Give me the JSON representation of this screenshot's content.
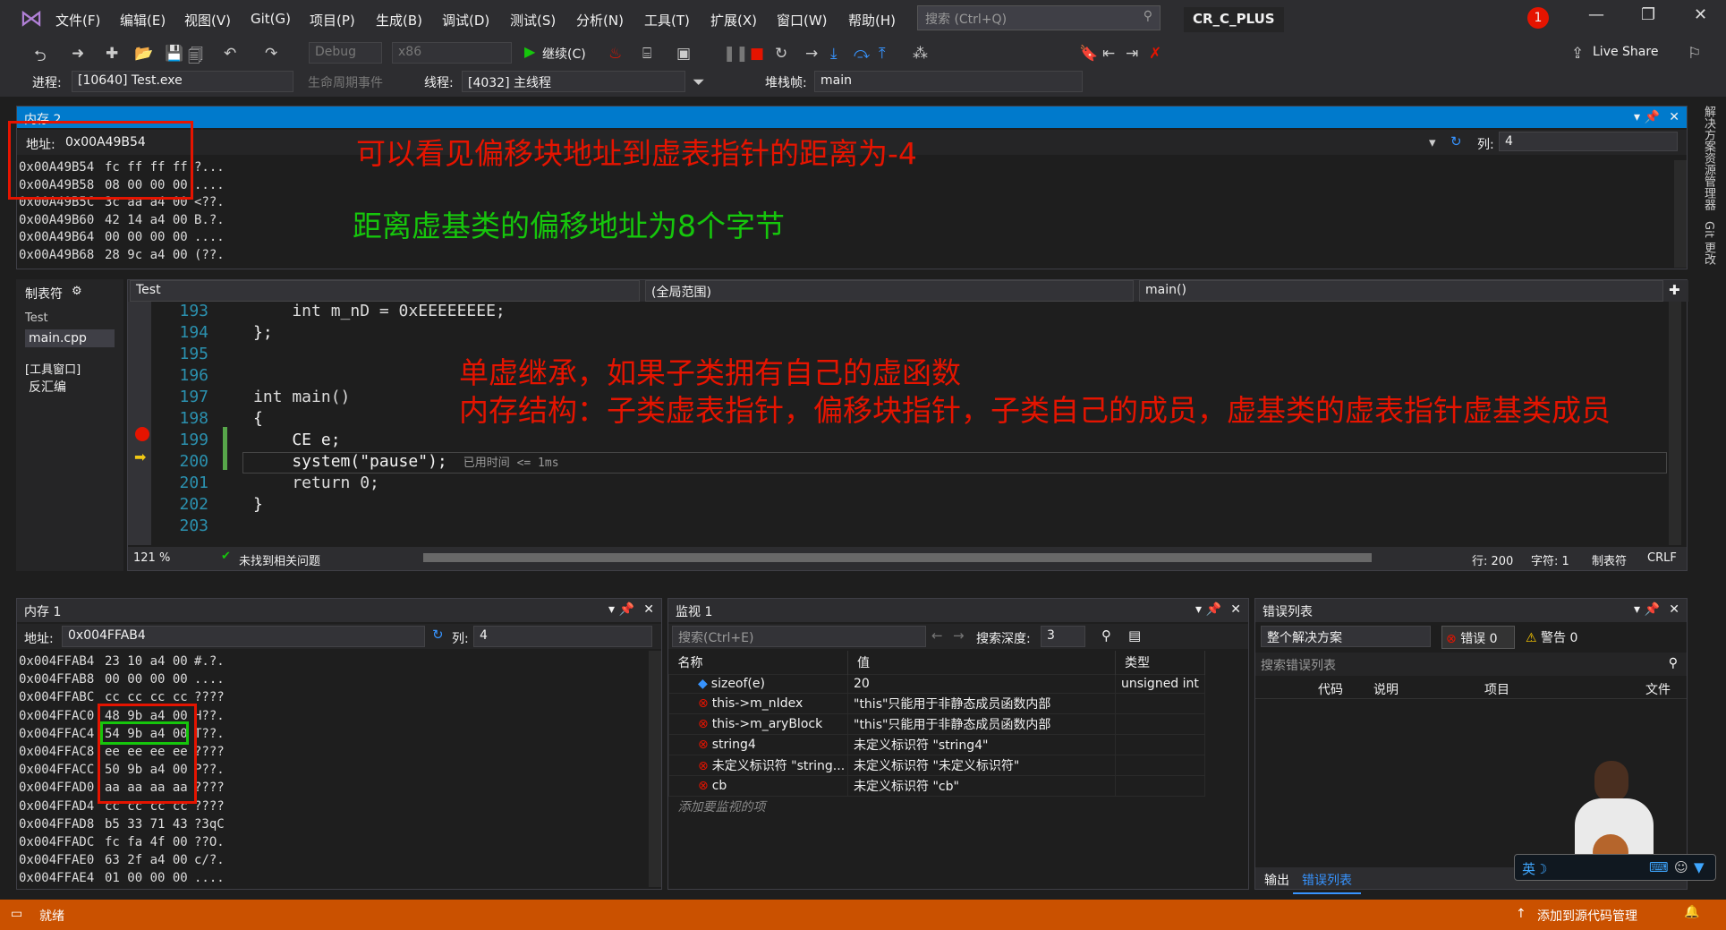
{
  "menubar": {
    "items": [
      "文件(F)",
      "编辑(E)",
      "视图(V)",
      "Git(G)",
      "项目(P)",
      "生成(B)",
      "调试(D)",
      "测试(S)",
      "分析(N)",
      "工具(T)",
      "扩展(X)",
      "窗口(W)",
      "帮助(H)"
    ],
    "search_placeholder": "搜索 (Ctrl+Q)",
    "solution_title": "CR_C_PLUS",
    "notification_count": "1"
  },
  "toolbar": {
    "config": "Debug",
    "platform": "x86",
    "continue_label": "继续(C)",
    "live_share": "Live Share"
  },
  "debugbar": {
    "process_label": "进程:",
    "process_value": "[10640] Test.exe",
    "lifecycle_label": "生命周期事件",
    "thread_label": "线程:",
    "thread_value": "[4032] 主线程",
    "stackframe_label": "堆栈帧:",
    "stackframe_value": "main"
  },
  "memory2": {
    "title": "内存 2",
    "address_label": "地址:",
    "address_value": "0x00A49B54",
    "col_label": "列:",
    "col_value": "4",
    "rows": [
      {
        "addr": "0x00A49B54",
        "bytes": "fc ff ff ff",
        "ascii": "?..."
      },
      {
        "addr": "0x00A49B58",
        "bytes": "08 00 00 00",
        "ascii": "...."
      },
      {
        "addr": "0x00A49B5C",
        "bytes": "3c aa a4 00",
        "ascii": "<??."
      },
      {
        "addr": "0x00A49B60",
        "bytes": "42 14 a4 00",
        "ascii": "B.?."
      },
      {
        "addr": "0x00A49B64",
        "bytes": "00 00 00 00",
        "ascii": "...."
      },
      {
        "addr": "0x00A49B68",
        "bytes": "28 9c a4 00",
        "ascii": "(??."
      }
    ]
  },
  "annotations": {
    "a1": "可以看见偏移块地址到虚表指针的距离为-4",
    "a2": "距离虚基类的偏移地址为8个字节",
    "a3": "单虚继承，如果子类拥有自己的虚函数",
    "a4": "内存结构：子类虚表指针，偏移块指针，子类自己的成员，虚基类的虚表指针虚基类成员"
  },
  "sidebar_right": {
    "solution_explorer": "解决方案资源管理器",
    "git_changes": "Git 更改"
  },
  "tabbar": {
    "title": "制表符",
    "items": [
      "Test",
      "main.cpp",
      "[工具窗口]",
      "反汇编"
    ]
  },
  "editor": {
    "project_combo": "Test",
    "scope_combo": "(全局范围)",
    "func_combo": "main()",
    "lines": [
      {
        "n": "193",
        "text": "    int m_nD = 0xEEEEEEEE;"
      },
      {
        "n": "194",
        "text": "};"
      },
      {
        "n": "195",
        "text": ""
      },
      {
        "n": "196",
        "text": ""
      },
      {
        "n": "197",
        "text": "int main()"
      },
      {
        "n": "198",
        "text": "{"
      },
      {
        "n": "199",
        "text": "    CE e;"
      },
      {
        "n": "200",
        "text": "    system(\"pause\");"
      },
      {
        "n": "201",
        "text": "    return 0;"
      },
      {
        "n": "202",
        "text": "}"
      },
      {
        "n": "203",
        "text": ""
      }
    ],
    "elapsed": "已用时间 <= 1ms",
    "zoom": "121 %",
    "issues": "未找到相关问题",
    "row": "行: 200",
    "char": "字符: 1",
    "tabs_mode": "制表符",
    "line_ending": "CRLF"
  },
  "memory1": {
    "title": "内存 1",
    "address_label": "地址:",
    "address_value": "0x004FFAB4",
    "col_label": "列:",
    "col_value": "4",
    "rows": [
      {
        "addr": "0x004FFAB4",
        "bytes": "23 10 a4 00",
        "ascii": "#.?."
      },
      {
        "addr": "0x004FFAB8",
        "bytes": "00 00 00 00",
        "ascii": "...."
      },
      {
        "addr": "0x004FFABC",
        "bytes": "cc cc cc cc",
        "ascii": "????"
      },
      {
        "addr": "0x004FFAC0",
        "bytes": "48 9b a4 00",
        "ascii": "H??."
      },
      {
        "addr": "0x004FFAC4",
        "bytes": "54 9b a4 00",
        "ascii": "T??."
      },
      {
        "addr": "0x004FFAC8",
        "bytes": "ee ee ee ee",
        "ascii": "????"
      },
      {
        "addr": "0x004FFACC",
        "bytes": "50 9b a4 00",
        "ascii": "P??."
      },
      {
        "addr": "0x004FFAD0",
        "bytes": "aa aa aa aa",
        "ascii": "????"
      },
      {
        "addr": "0x004FFAD4",
        "bytes": "cc cc cc cc",
        "ascii": "????"
      },
      {
        "addr": "0x004FFAD8",
        "bytes": "b5 33 71 43",
        "ascii": "?3qC"
      },
      {
        "addr": "0x004FFADC",
        "bytes": "fc fa 4f 00",
        "ascii": "??O."
      },
      {
        "addr": "0x004FFAE0",
        "bytes": "63 2f a4 00",
        "ascii": "c/?."
      },
      {
        "addr": "0x004FFAE4",
        "bytes": "01 00 00 00",
        "ascii": "...."
      }
    ]
  },
  "watch": {
    "title": "监视 1",
    "search_placeholder": "搜索(Ctrl+E)",
    "depth_label": "搜索深度:",
    "depth_value": "3",
    "col_name": "名称",
    "col_value": "值",
    "col_type": "类型",
    "rows": [
      {
        "name": "sizeof(e)",
        "value": "20",
        "type": "unsigned int"
      },
      {
        "name": "this->m_nIdex",
        "value": "\"this\"只能用于非静态成员函数内部",
        "type": ""
      },
      {
        "name": "this->m_aryBlock",
        "value": "\"this\"只能用于非静态成员函数内部",
        "type": ""
      },
      {
        "name": "string4",
        "value": "未定义标识符 \"string4\"",
        "type": ""
      },
      {
        "name": "未定义标识符 \"string...",
        "value": "未定义标识符 \"未定义标识符\"",
        "type": ""
      },
      {
        "name": "cb",
        "value": "未定义标识符 \"cb\"",
        "type": ""
      }
    ],
    "add_item": "添加要监视的项"
  },
  "errors": {
    "title": "错误列表",
    "scope": "整个解决方案",
    "errors": "错误 0",
    "warnings": "警告 0",
    "search_placeholder": "搜索错误列表",
    "col_code": "代码",
    "col_desc": "说明",
    "col_project": "项目",
    "col_file": "文件",
    "tab_output": "输出",
    "tab_errors": "错误列表"
  },
  "statusbar": {
    "ready": "就绪",
    "source_control": "添加到源代码管理"
  },
  "colors": {
    "accent": "#007acc",
    "status": "#ca5100",
    "annotation_red": "#e51400",
    "annotation_green": "#16c60c"
  }
}
